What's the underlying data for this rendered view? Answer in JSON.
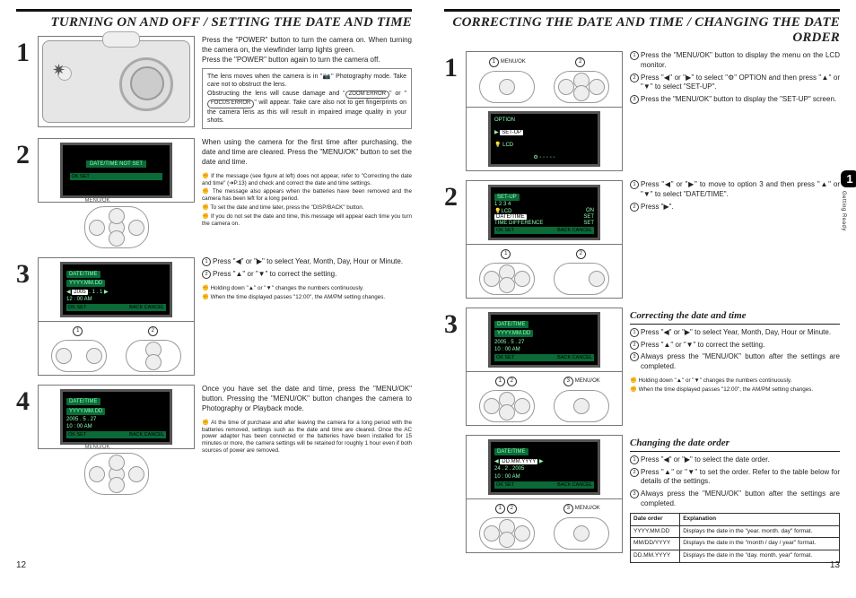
{
  "left": {
    "title": "TURNING ON AND OFF / SETTING THE DATE AND TIME",
    "page_num": "12",
    "step1": {
      "text": "Press the \"POWER\" button to turn the camera on. When turning the camera on, the viewfinder lamp lights green.\nPress the \"POWER\" button again to turn the camera off.",
      "note": "The lens moves when the camera is in \"📷\" Photography mode. Take care not to obstruct the lens.\nObstructing the lens will cause damage and \"  ZOOM ERROR  \" or \"  FOCUS ERROR  \" will appear. Take care also not to get fingerprints on the camera lens as this will result in impaired image quality in your shots.",
      "zoom_err": "ZOOM ERROR",
      "focus_err": "FOCUS ERROR"
    },
    "step2": {
      "screen_msg": "DATE/TIME NOT SET",
      "screen_ok": "OK SET",
      "dpad_label": "MENU/OK",
      "text": "When using the camera for the first time after purchasing, the date and time are cleared. Press the \"MENU/OK\" button to set the date and time.",
      "tiny1": "If the message (see figure at left) does not appear, refer to \"Correcting the date and time\" (➜P.13) and check and correct the date and time settings.",
      "tiny2": "The message also appears when the batteries have been removed and the camera has been left for a long period.",
      "tiny3": "To set the date and time later, press the \"DISP/BACK\" button.",
      "tiny4": "If you do not set the date and time, this message will appear each time you turn the camera on."
    },
    "step3": {
      "scr_hdr": "DATE/TIME",
      "scr_fmt": "YYYY.MM.DD",
      "scr_date_a": "2005",
      "scr_date_b": "1 . 1",
      "scr_time": "12 : 00    AM",
      "scr_ftr_l": "OK SET",
      "scr_ftr_r": "BACK CANCEL",
      "li1": "Press \"◀\" or \"▶\" to select Year, Month, Day, Hour or Minute.",
      "li2": "Press \"▲\" or \"▼\" to correct the setting.",
      "tiny1": "Holding down \"▲\" or \"▼\" changes the numbers continuously.",
      "tiny2": "When the time displayed passes \"12:00\", the AM/PM setting changes."
    },
    "step4": {
      "scr_hdr": "DATE/TIME",
      "scr_fmt": "YYYY.MM.DD",
      "scr_date": "2005 . 5 . 27",
      "scr_time": "10 : 00    AM",
      "scr_ftr_l": "OK SET",
      "scr_ftr_r": "BACK CANCEL",
      "dpad_label": "MENU/OK",
      "text": "Once you have set the date and time, press the \"MENU/OK\" button. Pressing the \"MENU/OK\" button changes the camera to Photography or Playback mode.",
      "tiny": "At the time of purchase and after leaving the camera for a long period with the batteries removed, settings such as the date and time are cleared. Once the AC power adapter has been connected or the batteries have been installed for 15 minutes or more, the camera settings will be retained for roughly 1 hour even if both sources of power are removed."
    }
  },
  "right": {
    "title": "CORRECTING THE DATE AND TIME / CHANGING THE DATE ORDER",
    "page_num": "13",
    "side_tab_num": "1",
    "side_tab_text": "Getting Ready",
    "step1": {
      "dpad_label": "MENU/OK",
      "scr_t1": "OPTION",
      "scr_t2": "SET-UP",
      "scr_t3": "LCD",
      "li1": "Press the \"MENU/OK\" button to display the menu on the LCD monitor.",
      "li2": "Press \"◀\" or \"▶\" to select \"⚙\" OPTION and then press \"▲\" or \"▼\" to select \"SET-UP\".",
      "li3": "Press the \"MENU/OK\" button to display the \"SET-UP\" screen."
    },
    "step2": {
      "scr_hdr": "SET-UP",
      "scr_r1_l": "LCD",
      "scr_r1_r": "ON",
      "scr_tabs": "1   2   3   4",
      "scr_r2_l": "DATE/TIME",
      "scr_r2_r": "SET",
      "scr_r3_l": "TIME DIFFERENCE",
      "scr_r3_r": "SET",
      "scr_ftr_l": "OK SET",
      "scr_ftr_r": "BACK CANCEL",
      "li1": "Press \"◀\" or \"▶\" to move to option 3 and then press \"▲\" or \"▼\" to select \"DATE/TIME\".",
      "li2": "Press \"▶\"."
    },
    "step3": {
      "heading": "Correcting the date and time",
      "scr_hdr": "DATE/TIME",
      "scr_fmt": "YYYY.MM.DD",
      "scr_date": "2005 . 5 . 27",
      "scr_time": "10 : 00    AM",
      "scr_ftr_l": "OK SET",
      "scr_ftr_r": "BACK CANCEL",
      "dpad_label": "MENU/OK",
      "li1": "Press \"◀\" or \"▶\" to select Year, Month, Day, Hour or Minute.",
      "li2": "Press \"▲\" or \"▼\" to correct the setting.",
      "li3": "Always press the \"MENU/OK\" button after the settings are completed.",
      "tiny1": "Holding down \"▲\" or \"▼\" changes the numbers continuously.",
      "tiny2": "When the time displayed passes \"12:00\", the AM/PM setting changes."
    },
    "step4": {
      "heading": "Changing the date order",
      "scr_hdr": "DATE/TIME",
      "scr_fmt": "DD.MM.YYYY",
      "scr_date": "24 . 2 . 2005",
      "scr_time": "10 : 00    AM",
      "scr_ftr_l": "OK SET",
      "scr_ftr_r": "BACK CANCEL",
      "dpad_label": "MENU/OK",
      "li1": "Press \"◀\" or \"▶\" to select the date order.",
      "li2": "Press \"▲\" or \"▼\" to set the order. Refer to the table below for details of the settings.",
      "li3": "Always press the \"MENU/OK\" button after the settings are completed.",
      "table": {
        "h1": "Date order",
        "h2": "Explanation",
        "r1a": "YYYY.MM.DD",
        "r1b": "Displays the date in the \"year. month. day\" format.",
        "r2a": "MM/DD/YYYY",
        "r2b": "Displays the date in the \"month / day / year\" format.",
        "r3a": "DD.MM.YYYY",
        "r3b": "Displays the date in the \"day. month. year\" format."
      }
    }
  }
}
